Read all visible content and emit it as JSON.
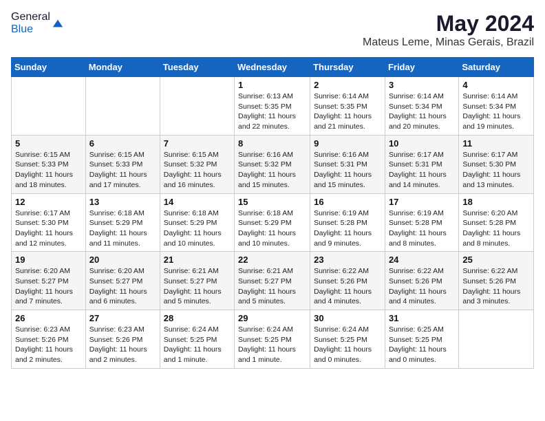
{
  "header": {
    "logo_general": "General",
    "logo_blue": "Blue",
    "title": "May 2024",
    "subtitle": "Mateus Leme, Minas Gerais, Brazil"
  },
  "weekdays": [
    "Sunday",
    "Monday",
    "Tuesday",
    "Wednesday",
    "Thursday",
    "Friday",
    "Saturday"
  ],
  "weeks": [
    [
      {
        "day": "",
        "info": ""
      },
      {
        "day": "",
        "info": ""
      },
      {
        "day": "",
        "info": ""
      },
      {
        "day": "1",
        "info": "Sunrise: 6:13 AM\nSunset: 5:35 PM\nDaylight: 11 hours and 22 minutes."
      },
      {
        "day": "2",
        "info": "Sunrise: 6:14 AM\nSunset: 5:35 PM\nDaylight: 11 hours and 21 minutes."
      },
      {
        "day": "3",
        "info": "Sunrise: 6:14 AM\nSunset: 5:34 PM\nDaylight: 11 hours and 20 minutes."
      },
      {
        "day": "4",
        "info": "Sunrise: 6:14 AM\nSunset: 5:34 PM\nDaylight: 11 hours and 19 minutes."
      }
    ],
    [
      {
        "day": "5",
        "info": "Sunrise: 6:15 AM\nSunset: 5:33 PM\nDaylight: 11 hours and 18 minutes."
      },
      {
        "day": "6",
        "info": "Sunrise: 6:15 AM\nSunset: 5:33 PM\nDaylight: 11 hours and 17 minutes."
      },
      {
        "day": "7",
        "info": "Sunrise: 6:15 AM\nSunset: 5:32 PM\nDaylight: 11 hours and 16 minutes."
      },
      {
        "day": "8",
        "info": "Sunrise: 6:16 AM\nSunset: 5:32 PM\nDaylight: 11 hours and 15 minutes."
      },
      {
        "day": "9",
        "info": "Sunrise: 6:16 AM\nSunset: 5:31 PM\nDaylight: 11 hours and 15 minutes."
      },
      {
        "day": "10",
        "info": "Sunrise: 6:17 AM\nSunset: 5:31 PM\nDaylight: 11 hours and 14 minutes."
      },
      {
        "day": "11",
        "info": "Sunrise: 6:17 AM\nSunset: 5:30 PM\nDaylight: 11 hours and 13 minutes."
      }
    ],
    [
      {
        "day": "12",
        "info": "Sunrise: 6:17 AM\nSunset: 5:30 PM\nDaylight: 11 hours and 12 minutes."
      },
      {
        "day": "13",
        "info": "Sunrise: 6:18 AM\nSunset: 5:29 PM\nDaylight: 11 hours and 11 minutes."
      },
      {
        "day": "14",
        "info": "Sunrise: 6:18 AM\nSunset: 5:29 PM\nDaylight: 11 hours and 10 minutes."
      },
      {
        "day": "15",
        "info": "Sunrise: 6:18 AM\nSunset: 5:29 PM\nDaylight: 11 hours and 10 minutes."
      },
      {
        "day": "16",
        "info": "Sunrise: 6:19 AM\nSunset: 5:28 PM\nDaylight: 11 hours and 9 minutes."
      },
      {
        "day": "17",
        "info": "Sunrise: 6:19 AM\nSunset: 5:28 PM\nDaylight: 11 hours and 8 minutes."
      },
      {
        "day": "18",
        "info": "Sunrise: 6:20 AM\nSunset: 5:28 PM\nDaylight: 11 hours and 8 minutes."
      }
    ],
    [
      {
        "day": "19",
        "info": "Sunrise: 6:20 AM\nSunset: 5:27 PM\nDaylight: 11 hours and 7 minutes."
      },
      {
        "day": "20",
        "info": "Sunrise: 6:20 AM\nSunset: 5:27 PM\nDaylight: 11 hours and 6 minutes."
      },
      {
        "day": "21",
        "info": "Sunrise: 6:21 AM\nSunset: 5:27 PM\nDaylight: 11 hours and 5 minutes."
      },
      {
        "day": "22",
        "info": "Sunrise: 6:21 AM\nSunset: 5:27 PM\nDaylight: 11 hours and 5 minutes."
      },
      {
        "day": "23",
        "info": "Sunrise: 6:22 AM\nSunset: 5:26 PM\nDaylight: 11 hours and 4 minutes."
      },
      {
        "day": "24",
        "info": "Sunrise: 6:22 AM\nSunset: 5:26 PM\nDaylight: 11 hours and 4 minutes."
      },
      {
        "day": "25",
        "info": "Sunrise: 6:22 AM\nSunset: 5:26 PM\nDaylight: 11 hours and 3 minutes."
      }
    ],
    [
      {
        "day": "26",
        "info": "Sunrise: 6:23 AM\nSunset: 5:26 PM\nDaylight: 11 hours and 2 minutes."
      },
      {
        "day": "27",
        "info": "Sunrise: 6:23 AM\nSunset: 5:26 PM\nDaylight: 11 hours and 2 minutes."
      },
      {
        "day": "28",
        "info": "Sunrise: 6:24 AM\nSunset: 5:25 PM\nDaylight: 11 hours and 1 minute."
      },
      {
        "day": "29",
        "info": "Sunrise: 6:24 AM\nSunset: 5:25 PM\nDaylight: 11 hours and 1 minute."
      },
      {
        "day": "30",
        "info": "Sunrise: 6:24 AM\nSunset: 5:25 PM\nDaylight: 11 hours and 0 minutes."
      },
      {
        "day": "31",
        "info": "Sunrise: 6:25 AM\nSunset: 5:25 PM\nDaylight: 11 hours and 0 minutes."
      },
      {
        "day": "",
        "info": ""
      }
    ]
  ]
}
